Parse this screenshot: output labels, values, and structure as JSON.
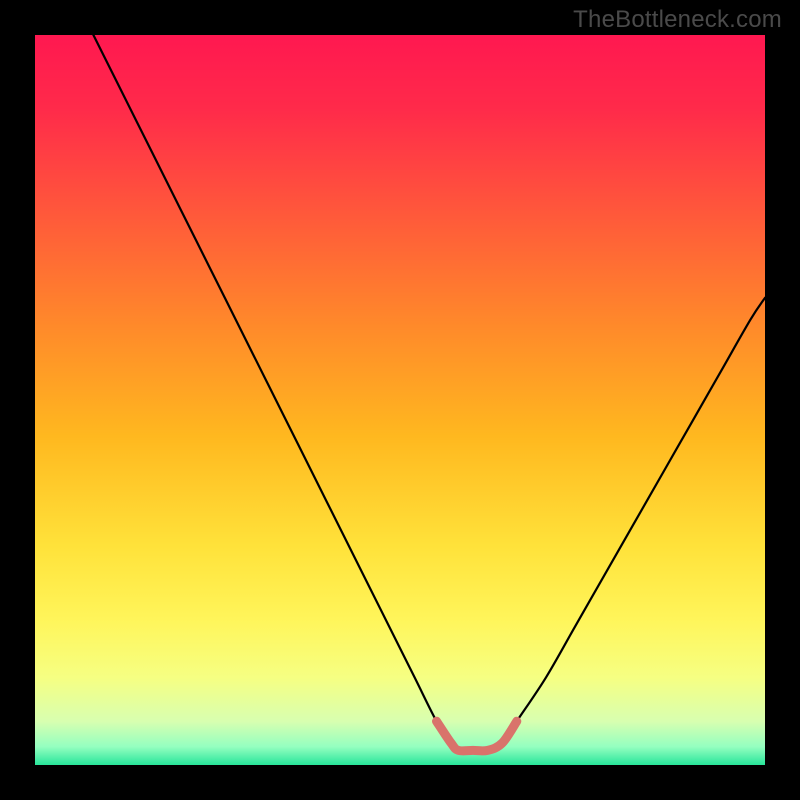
{
  "watermark": "TheBottleneck.com",
  "colors": {
    "bg": "#000000",
    "curve": "#000000",
    "highlight": "#d9736b",
    "gradient_stops": [
      {
        "offset": 0.0,
        "color": "#ff1850"
      },
      {
        "offset": 0.1,
        "color": "#ff2a4a"
      },
      {
        "offset": 0.25,
        "color": "#ff5a3a"
      },
      {
        "offset": 0.4,
        "color": "#ff8a2a"
      },
      {
        "offset": 0.55,
        "color": "#ffb81f"
      },
      {
        "offset": 0.7,
        "color": "#ffe23a"
      },
      {
        "offset": 0.8,
        "color": "#fff55a"
      },
      {
        "offset": 0.88,
        "color": "#f6ff82"
      },
      {
        "offset": 0.94,
        "color": "#d8ffb0"
      },
      {
        "offset": 0.975,
        "color": "#94ffc0"
      },
      {
        "offset": 1.0,
        "color": "#28e59a"
      }
    ]
  },
  "chart_data": {
    "type": "line",
    "title": "",
    "xlabel": "",
    "ylabel": "",
    "xlim": [
      0,
      100
    ],
    "ylim": [
      0,
      100
    ],
    "grid": false,
    "legend": false,
    "series": [
      {
        "name": "bottleneck-curve",
        "x": [
          8,
          12,
          16,
          20,
          24,
          28,
          32,
          36,
          40,
          44,
          48,
          52,
          55,
          57,
          58,
          60,
          62,
          64,
          66,
          70,
          74,
          78,
          82,
          86,
          90,
          94,
          98,
          100
        ],
        "y": [
          100,
          92,
          84,
          76,
          68,
          60,
          52,
          44,
          36,
          28,
          20,
          12,
          6,
          3,
          2,
          2,
          2,
          3,
          6,
          12,
          19,
          26,
          33,
          40,
          47,
          54,
          61,
          64
        ]
      },
      {
        "name": "optimal-range-highlight",
        "x": [
          55,
          57,
          58,
          60,
          62,
          64,
          66
        ],
        "y": [
          6,
          3,
          2,
          2,
          2,
          3,
          6
        ]
      }
    ],
    "annotations": []
  }
}
